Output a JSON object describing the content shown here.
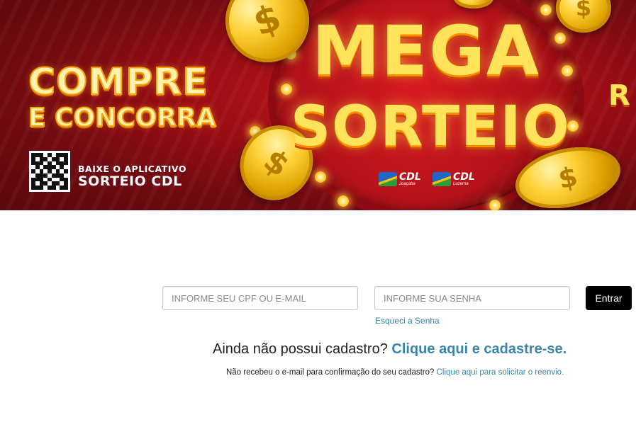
{
  "banner": {
    "headline_line1": "COMPRE",
    "headline_line2": "E CONCORRA",
    "mega": "MEGA",
    "sorteio": "SORTEIO",
    "app_line1": "BAIXE O APLICATIVO",
    "app_line2": "SORTEIO CDL",
    "partners": [
      {
        "name": "CDL",
        "city": "Joaçaba"
      },
      {
        "name": "CDL",
        "city": "Luzerna"
      }
    ],
    "edge_letter": "R",
    "colors": {
      "background": "#9a0d14",
      "gold": "#ffe35a",
      "accent": "#ff8a00"
    }
  },
  "login": {
    "user_placeholder": "INFORME SEU CPF OU E-MAIL",
    "password_placeholder": "INFORME SUA SENHA",
    "submit_label": "Entrar",
    "forgot_label": "Esqueci a Senha"
  },
  "signup": {
    "question": "Ainda não possui cadastro?",
    "link": "Clique aqui e cadastre-se."
  },
  "resend": {
    "question": "Não recebeu o e-mail para confirmação do seu cadastro?",
    "link": "Clique aqui para solicitar o reenvio."
  }
}
